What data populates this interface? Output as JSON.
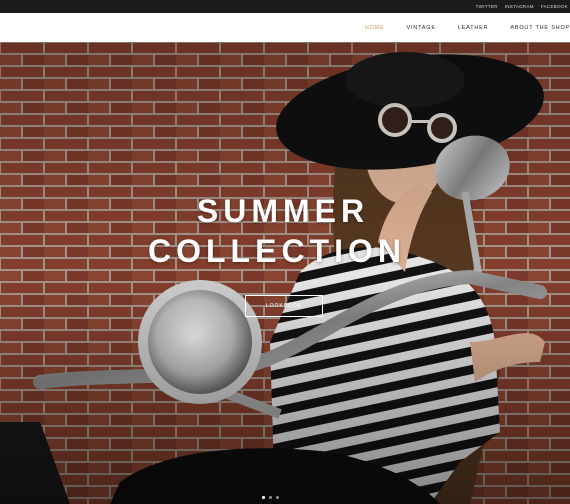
{
  "topbar": {
    "social_links": [
      "TWITTER",
      "INSTAGRAM",
      "FACEBOOK"
    ]
  },
  "nav": {
    "items": [
      "HOME",
      "VINTAGE",
      "LEATHER",
      "ABOUT THE SHOP"
    ],
    "active": "HOME"
  },
  "hero": {
    "headline_line1": "SUMMER",
    "headline_line2": "COLLECTION",
    "button_label": "LOOKBOOK",
    "slide_count": 3,
    "active_slide": 1
  },
  "colors": {
    "accent": "#c7a052",
    "topbar": "#1b1b1b",
    "brick": "#8a4533"
  }
}
